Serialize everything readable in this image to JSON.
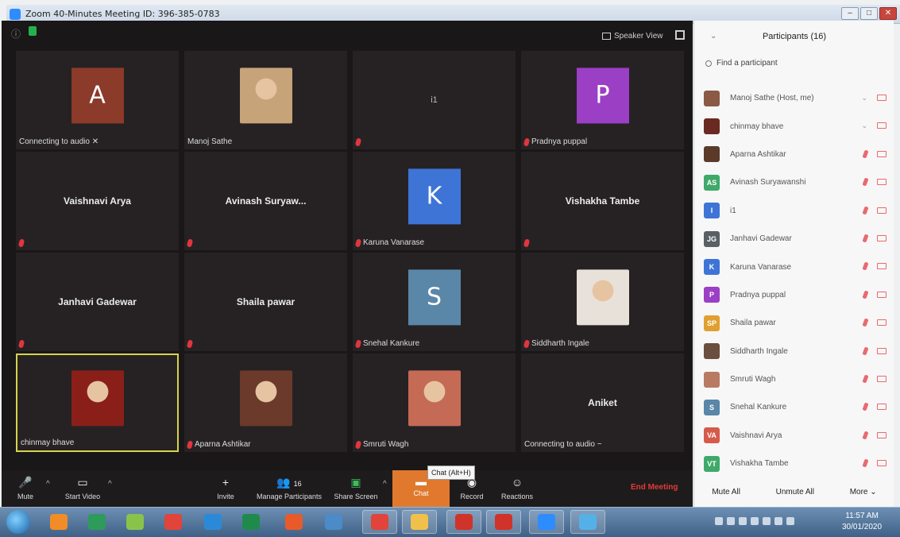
{
  "window": {
    "title": "Zoom 40-Minutes Meeting ID: 396-385-0783"
  },
  "video": {
    "view_label": "Speaker View"
  },
  "tiles": [
    {
      "type": "avatar",
      "letter": "A",
      "color": "#8c3a2a",
      "name": "Connecting to audio ✕",
      "mic_off": false
    },
    {
      "type": "photo",
      "photo_color": "#c7a37a",
      "name": "Manoj Sathe",
      "mic_off": false
    },
    {
      "type": "id",
      "text": "i1",
      "name": "",
      "mic_off": true
    },
    {
      "type": "avatar",
      "letter": "P",
      "color": "#9b3fc4",
      "name": "Pradnya puppal",
      "mic_off": true
    },
    {
      "type": "name",
      "center": "Vaishnavi Arya",
      "name": "",
      "mic_off": true
    },
    {
      "type": "name",
      "center": "Avinash  Suryaw...",
      "name": "",
      "mic_off": true
    },
    {
      "type": "avatar",
      "letter": "K",
      "color": "#3e74d6",
      "name": "Karuna Vanarase",
      "mic_off": true
    },
    {
      "type": "name",
      "center": "Vishakha Tambe",
      "name": "",
      "mic_off": true
    },
    {
      "type": "name",
      "center": "Janhavi Gadewar",
      "name": "",
      "mic_off": true
    },
    {
      "type": "name",
      "center": "Shaila pawar",
      "name": "",
      "mic_off": true
    },
    {
      "type": "avatar",
      "letter": "S",
      "color": "#5a86a8",
      "name": "Snehal Kankure",
      "mic_off": true
    },
    {
      "type": "photo",
      "photo_color": "#e8e1da",
      "name": "Siddharth Ingale",
      "mic_off": true
    },
    {
      "type": "photo",
      "photo_color": "#8a1f1a",
      "name": "chinmay bhave",
      "mic_off": false,
      "active": true
    },
    {
      "type": "photo",
      "photo_color": "#6b3a2a",
      "name": "Aparna Ashtikar",
      "mic_off": true
    },
    {
      "type": "photo",
      "photo_color": "#c46a55",
      "name": "Smruti Wagh",
      "mic_off": true
    },
    {
      "type": "name",
      "center": "Aniket",
      "name": "Connecting to audio ~",
      "mic_off": false
    }
  ],
  "controls": {
    "mute": "Mute",
    "start_video": "Start Video",
    "invite": "Invite",
    "manage_participants": "Manage Participants",
    "participants_count": "16",
    "share_screen": "Share Screen",
    "chat": "Chat",
    "chat_tooltip": "Chat (Alt+H)",
    "record": "Record",
    "reactions": "Reactions",
    "end_meeting": "End Meeting"
  },
  "panel": {
    "title": "Participants (16)",
    "search_placeholder": "Find a participant",
    "participants": [
      {
        "initials": "",
        "color": "#8a5a45",
        "name": "Manoj Sathe (Host, me)",
        "caret": true
      },
      {
        "initials": "",
        "color": "#6a2a22",
        "name": "chinmay bhave",
        "caret": true
      },
      {
        "initials": "",
        "color": "#5b3a2a",
        "name": "Aparna Ashtikar",
        "caret": false
      },
      {
        "initials": "AS",
        "color": "#3fa96a",
        "name": "Avinash Suryawanshi",
        "caret": false
      },
      {
        "initials": "I",
        "color": "#3e74d6",
        "name": "i1",
        "caret": false
      },
      {
        "initials": "JG",
        "color": "#5a5f66",
        "name": "Janhavi Gadewar",
        "caret": false
      },
      {
        "initials": "K",
        "color": "#3e74d6",
        "name": "Karuna Vanarase",
        "caret": false
      },
      {
        "initials": "P",
        "color": "#9b3fc4",
        "name": "Pradnya puppal",
        "caret": false
      },
      {
        "initials": "SP",
        "color": "#e0a030",
        "name": "Shaila pawar",
        "caret": false
      },
      {
        "initials": "",
        "color": "#6b4e3e",
        "name": "Siddharth Ingale",
        "caret": false
      },
      {
        "initials": "",
        "color": "#b87a62",
        "name": "Smruti Wagh",
        "caret": false
      },
      {
        "initials": "S",
        "color": "#5a86a8",
        "name": "Snehal Kankure",
        "caret": false
      },
      {
        "initials": "VA",
        "color": "#d65a4a",
        "name": "Vaishnavi Arya",
        "caret": false
      },
      {
        "initials": "VT",
        "color": "#3fa96a",
        "name": "Vishakha Tambe",
        "caret": false
      }
    ],
    "mute_all": "Mute All",
    "unmute_all": "Unmute All",
    "more": "More ⌄"
  },
  "taskbar": {
    "apps": [
      {
        "name": "media-player",
        "color": "#f28c28"
      },
      {
        "name": "notepad",
        "color": "#2d9b5a"
      },
      {
        "name": "android",
        "color": "#8ac34a"
      },
      {
        "name": "chrome",
        "color": "#e0443a"
      },
      {
        "name": "internet-explorer",
        "color": "#2b8ad8"
      },
      {
        "name": "excel",
        "color": "#1f8a4c"
      },
      {
        "name": "mi",
        "color": "#e85a2a"
      },
      {
        "name": "photos",
        "color": "#4a8bc8"
      },
      {
        "name": "chrome-2",
        "color": "#e0443a"
      },
      {
        "name": "file-explorer",
        "color": "#f0c14a"
      },
      {
        "name": "acrobat",
        "color": "#d0332a"
      },
      {
        "name": "powerpoint",
        "color": "#d0332a"
      },
      {
        "name": "zoom",
        "color": "#2d8cff"
      },
      {
        "name": "screen-share",
        "color": "#56b0e8"
      }
    ],
    "time": "11:57 AM",
    "date": "30/01/2020"
  }
}
